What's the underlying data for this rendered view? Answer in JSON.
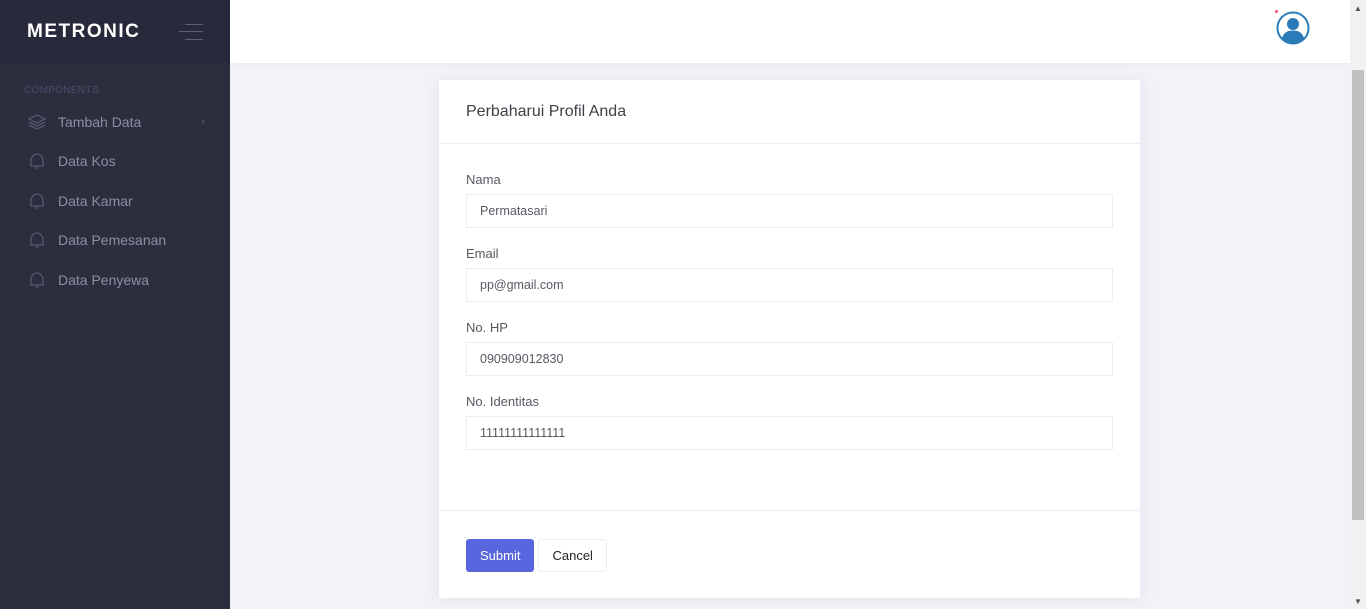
{
  "brand": {
    "name": "METRONIC"
  },
  "sidebar": {
    "section_title": "COMPONENTS",
    "items": [
      {
        "label": "Tambah Data",
        "icon": "layers-icon",
        "has_submenu": true
      },
      {
        "label": "Data Kos",
        "icon": "bell-icon",
        "has_submenu": false
      },
      {
        "label": "Data Kamar",
        "icon": "bell-icon",
        "has_submenu": false
      },
      {
        "label": "Data Pemesanan",
        "icon": "bell-icon",
        "has_submenu": false
      },
      {
        "label": "Data Penyewa",
        "icon": "bell-icon",
        "has_submenu": false
      }
    ],
    "submenu_arrow": "›"
  },
  "header": {
    "avatar_icon": "user-avatar-icon"
  },
  "card": {
    "title": "Perbaharui Profil Anda",
    "fields": [
      {
        "label": "Nama",
        "value": "Permatasari"
      },
      {
        "label": "Email",
        "value": "pp@gmail.com"
      },
      {
        "label": "No. HP",
        "value": "090909012830"
      },
      {
        "label": "No. Identitas",
        "value": "11111111111111"
      }
    ],
    "submit_label": "Submit",
    "cancel_label": "Cancel"
  },
  "colors": {
    "sidebar_bg": "#2c2e3e",
    "brand_bg": "#282a3c",
    "primary": "#5867dd",
    "avatar": "#2b7bb9"
  }
}
